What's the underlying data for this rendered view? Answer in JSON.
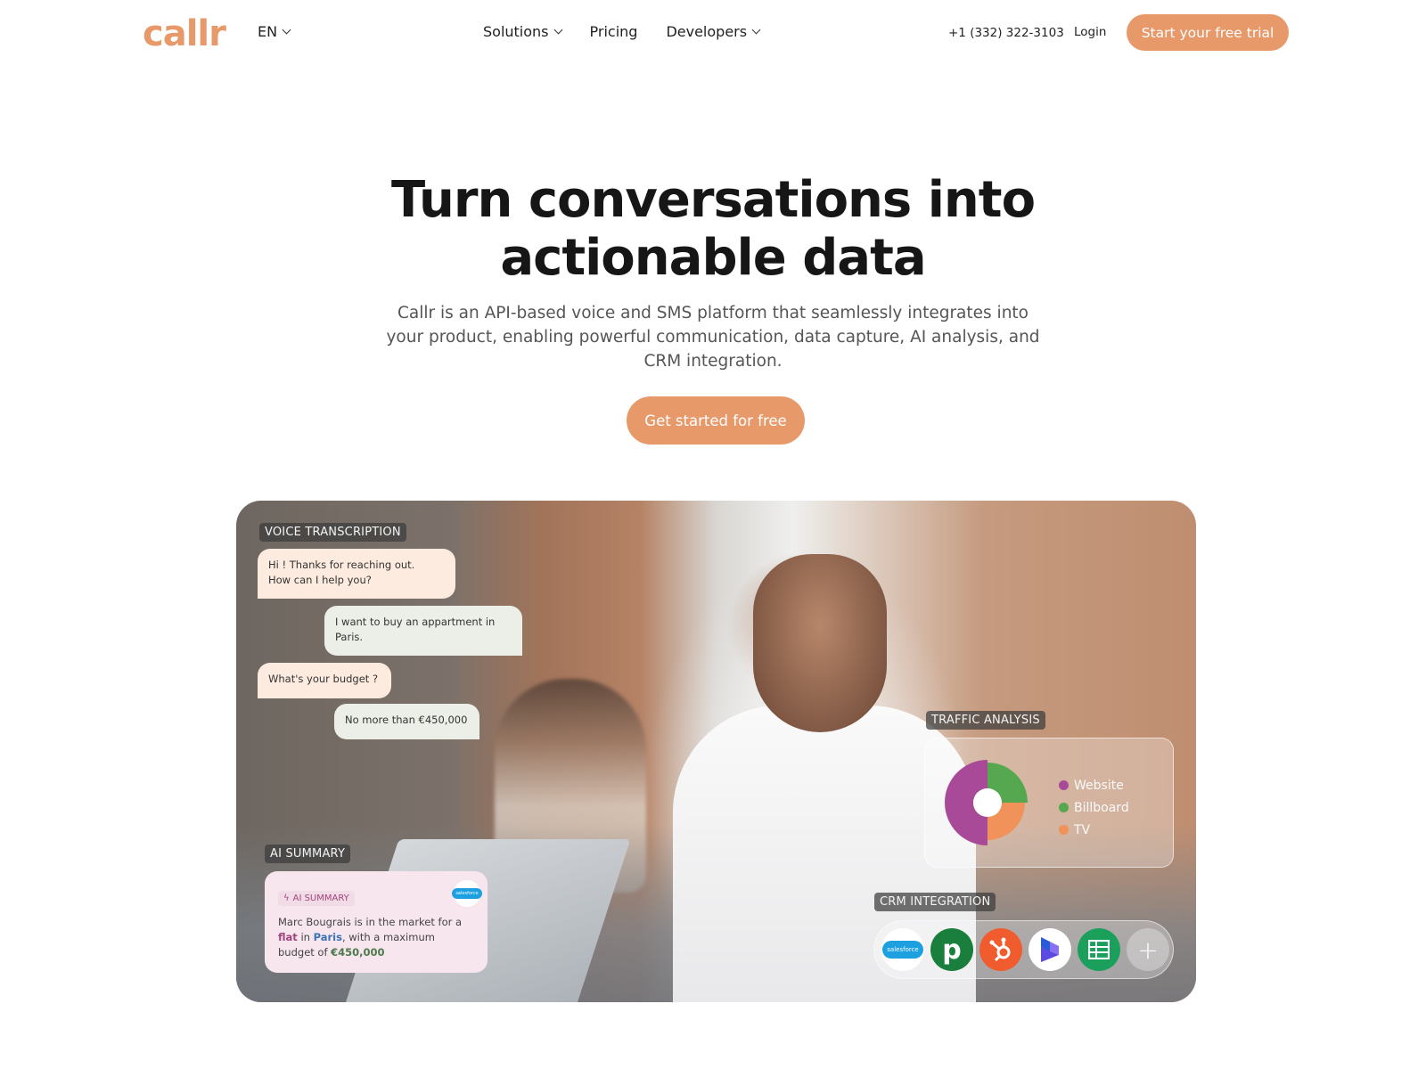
{
  "nav": {
    "logo": "callr",
    "language": "EN",
    "menu": [
      {
        "label": "Solutions",
        "has_dropdown": true
      },
      {
        "label": "Pricing",
        "has_dropdown": false
      },
      {
        "label": "Developers",
        "has_dropdown": true
      }
    ],
    "phone": "+1 (332) 322-3103",
    "login": "Login",
    "trial_button": "Start your free trial"
  },
  "hero": {
    "title_line1": "Turn conversations into",
    "title_line2": "actionable data",
    "subtitle": "Callr is an API-based voice and SMS platform that seamlessly integrates into your product, enabling powerful communication, data capture, AI analysis, and CRM integration.",
    "cta": "Get started for free"
  },
  "panel": {
    "voice_transcription": {
      "label": "VOICE TRANSCRIPTION",
      "messages": [
        {
          "speaker": "agent",
          "line1": "Hi ! Thanks for reaching out.",
          "line2": "How can I help you?"
        },
        {
          "speaker": "user",
          "line1": "I want to buy an appartment in",
          "line2": "Paris."
        },
        {
          "speaker": "agent",
          "line1": "What's your budget ?",
          "line2": ""
        },
        {
          "speaker": "user",
          "line1": "No more than €450,000",
          "line2": ""
        }
      ]
    },
    "ai_summary": {
      "label": "AI SUMMARY",
      "chip": "AI SUMMARY",
      "chip_icon": "lightning-icon",
      "crm_badge": "salesforce",
      "text_before": "Marc Bougrais is in the market for a ",
      "kw_flat": "flat",
      "text_mid1": " in ",
      "kw_paris": "Paris",
      "text_mid2": ", with a maximum budget of ",
      "kw_budget": "€450,000"
    },
    "traffic_analysis": {
      "label": "TRAFFIC ANALYSIS"
    },
    "crm_integration": {
      "label": "CRM INTEGRATION",
      "integrations": [
        "salesforce",
        "pipedrive",
        "hubspot",
        "dynamics",
        "google-sheets",
        "add"
      ]
    }
  },
  "chart_data": {
    "type": "pie",
    "title": "TRAFFIC ANALYSIS",
    "donut": true,
    "categories": [
      "Website",
      "Billboard",
      "TV"
    ],
    "values": [
      50,
      25,
      25
    ],
    "colors": [
      "#a84a97",
      "#55a84f",
      "#f0925a"
    ],
    "legend": "right"
  }
}
